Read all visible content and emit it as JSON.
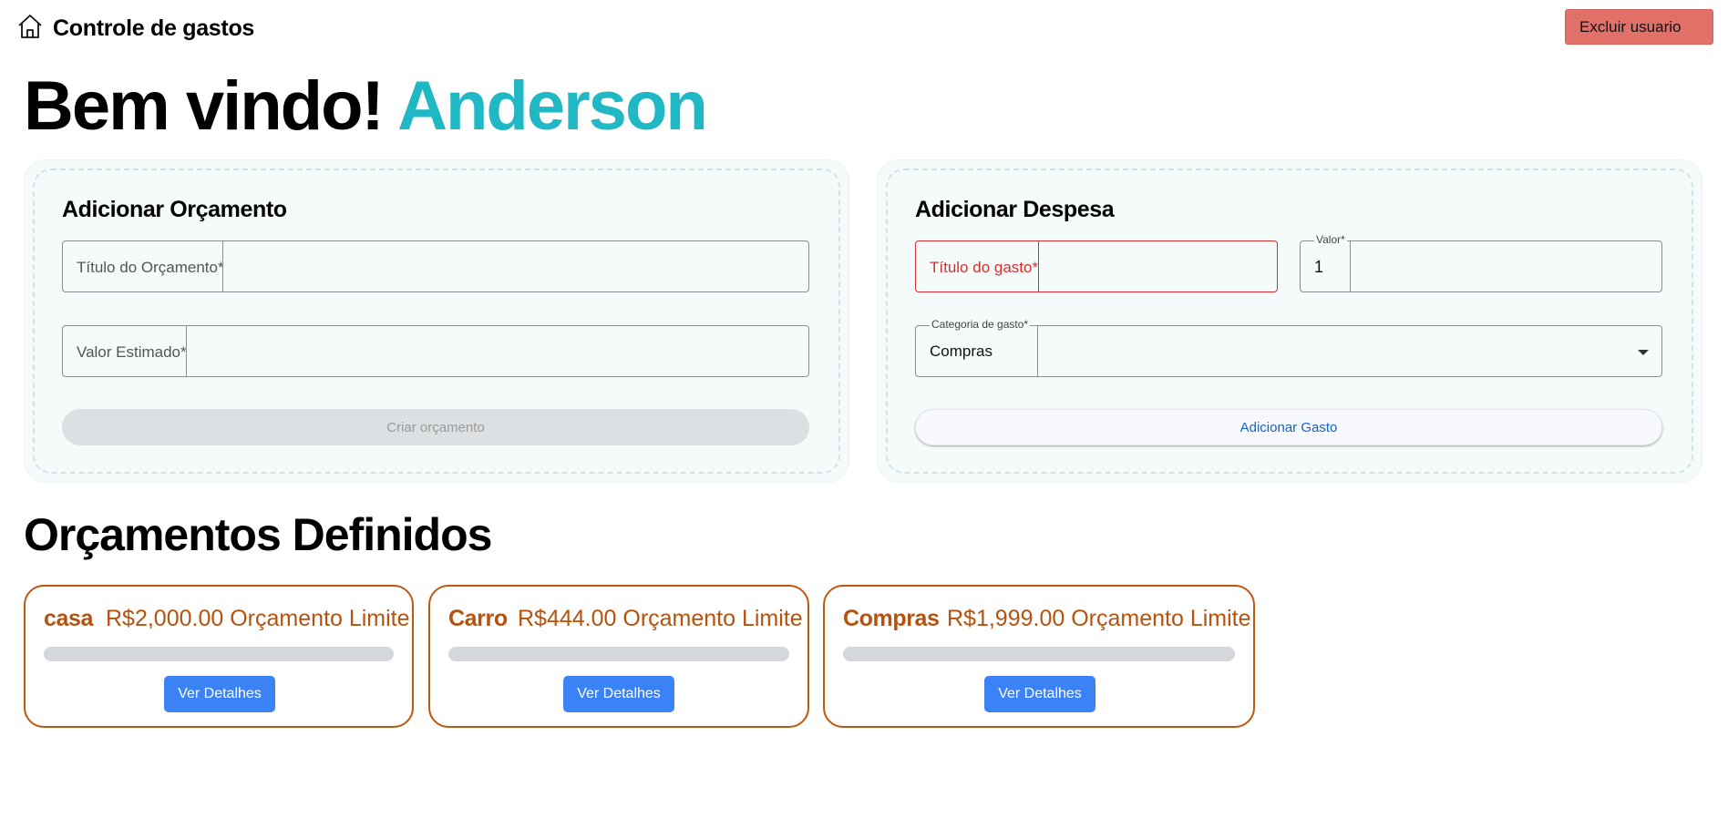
{
  "header": {
    "home_icon": "home-icon",
    "title": "Controle de gastos",
    "delete_user_label": "Excluir usuario"
  },
  "welcome": {
    "greeting": "Bem vindo!",
    "user_name": "Anderson",
    "name_color": "#1fb8c4"
  },
  "budget_form": {
    "title": "Adicionar Orçamento",
    "title_field_label": "Título do Orçamento",
    "title_field_value": "",
    "amount_field_label": "Valor Estimado",
    "amount_field_value": "",
    "required_mark": "*",
    "submit_label": "Criar orçamento"
  },
  "expense_form": {
    "title": "Adicionar Despesa",
    "name_field_label": "Título do gasto",
    "name_field_value": "",
    "value_field_label": "Valor*",
    "value_field_value": "1",
    "category_field_label": "Categoria de gasto*",
    "category_selected": "Compras",
    "required_mark": "*",
    "submit_label": "Adicionar Gasto"
  },
  "budgets_section": {
    "title": "Orçamentos Definidos",
    "detail_button_label": "Ver Detalhes",
    "accent_color": "#b5520d",
    "items": [
      {
        "name": "casa",
        "amount": "R$2,000.00 Orçamento Limite",
        "progress": 0
      },
      {
        "name": "Carro",
        "amount": "R$444.00 Orçamento Limite",
        "progress": 0
      },
      {
        "name": "Compras",
        "amount": "R$1,999.00 Orçamento Limite",
        "progress": 0
      }
    ]
  }
}
